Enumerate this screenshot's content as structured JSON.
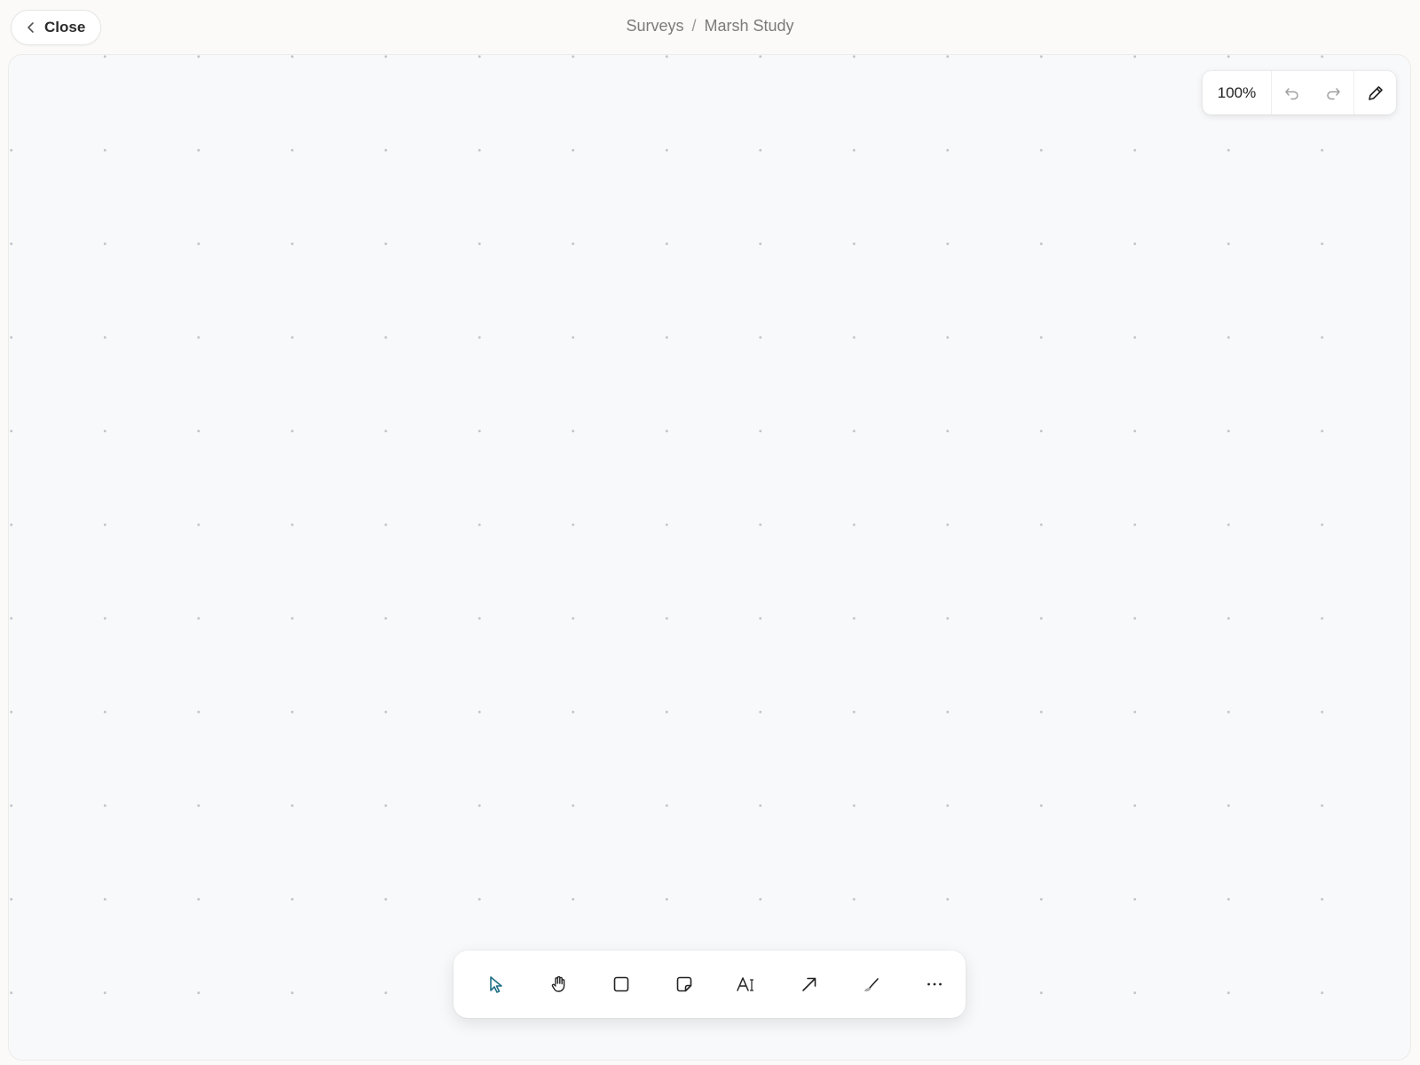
{
  "header": {
    "close_label": "Close",
    "breadcrumb": [
      "Surveys",
      "Marsh Study"
    ],
    "breadcrumb_separator": "/"
  },
  "canvas_toolbar": {
    "zoom": "100%",
    "undo_icon": "undo-icon",
    "redo_icon": "redo-icon",
    "edit_icon": "pencil-icon"
  },
  "tools": [
    {
      "name": "select",
      "icon": "cursor-arrow-icon",
      "active": true
    },
    {
      "name": "hand",
      "icon": "hand-icon",
      "active": false
    },
    {
      "name": "rectangle",
      "icon": "square-icon",
      "active": false
    },
    {
      "name": "sticky-note",
      "icon": "sticky-note-icon",
      "active": false
    },
    {
      "name": "text",
      "icon": "text-icon",
      "active": false
    },
    {
      "name": "arrow",
      "icon": "arrow-icon",
      "active": false
    },
    {
      "name": "draw",
      "icon": "pen-icon",
      "active": false
    },
    {
      "name": "more",
      "icon": "more-horizontal-icon",
      "active": false
    }
  ],
  "colors": {
    "page_bg": "#fbfaf9",
    "canvas_bg": "#f8f9fa",
    "grid_dot": "#c3c6ca",
    "accent": "#1f6f86",
    "icon": "#2a2a2a",
    "icon_muted": "#9a9a9a"
  }
}
